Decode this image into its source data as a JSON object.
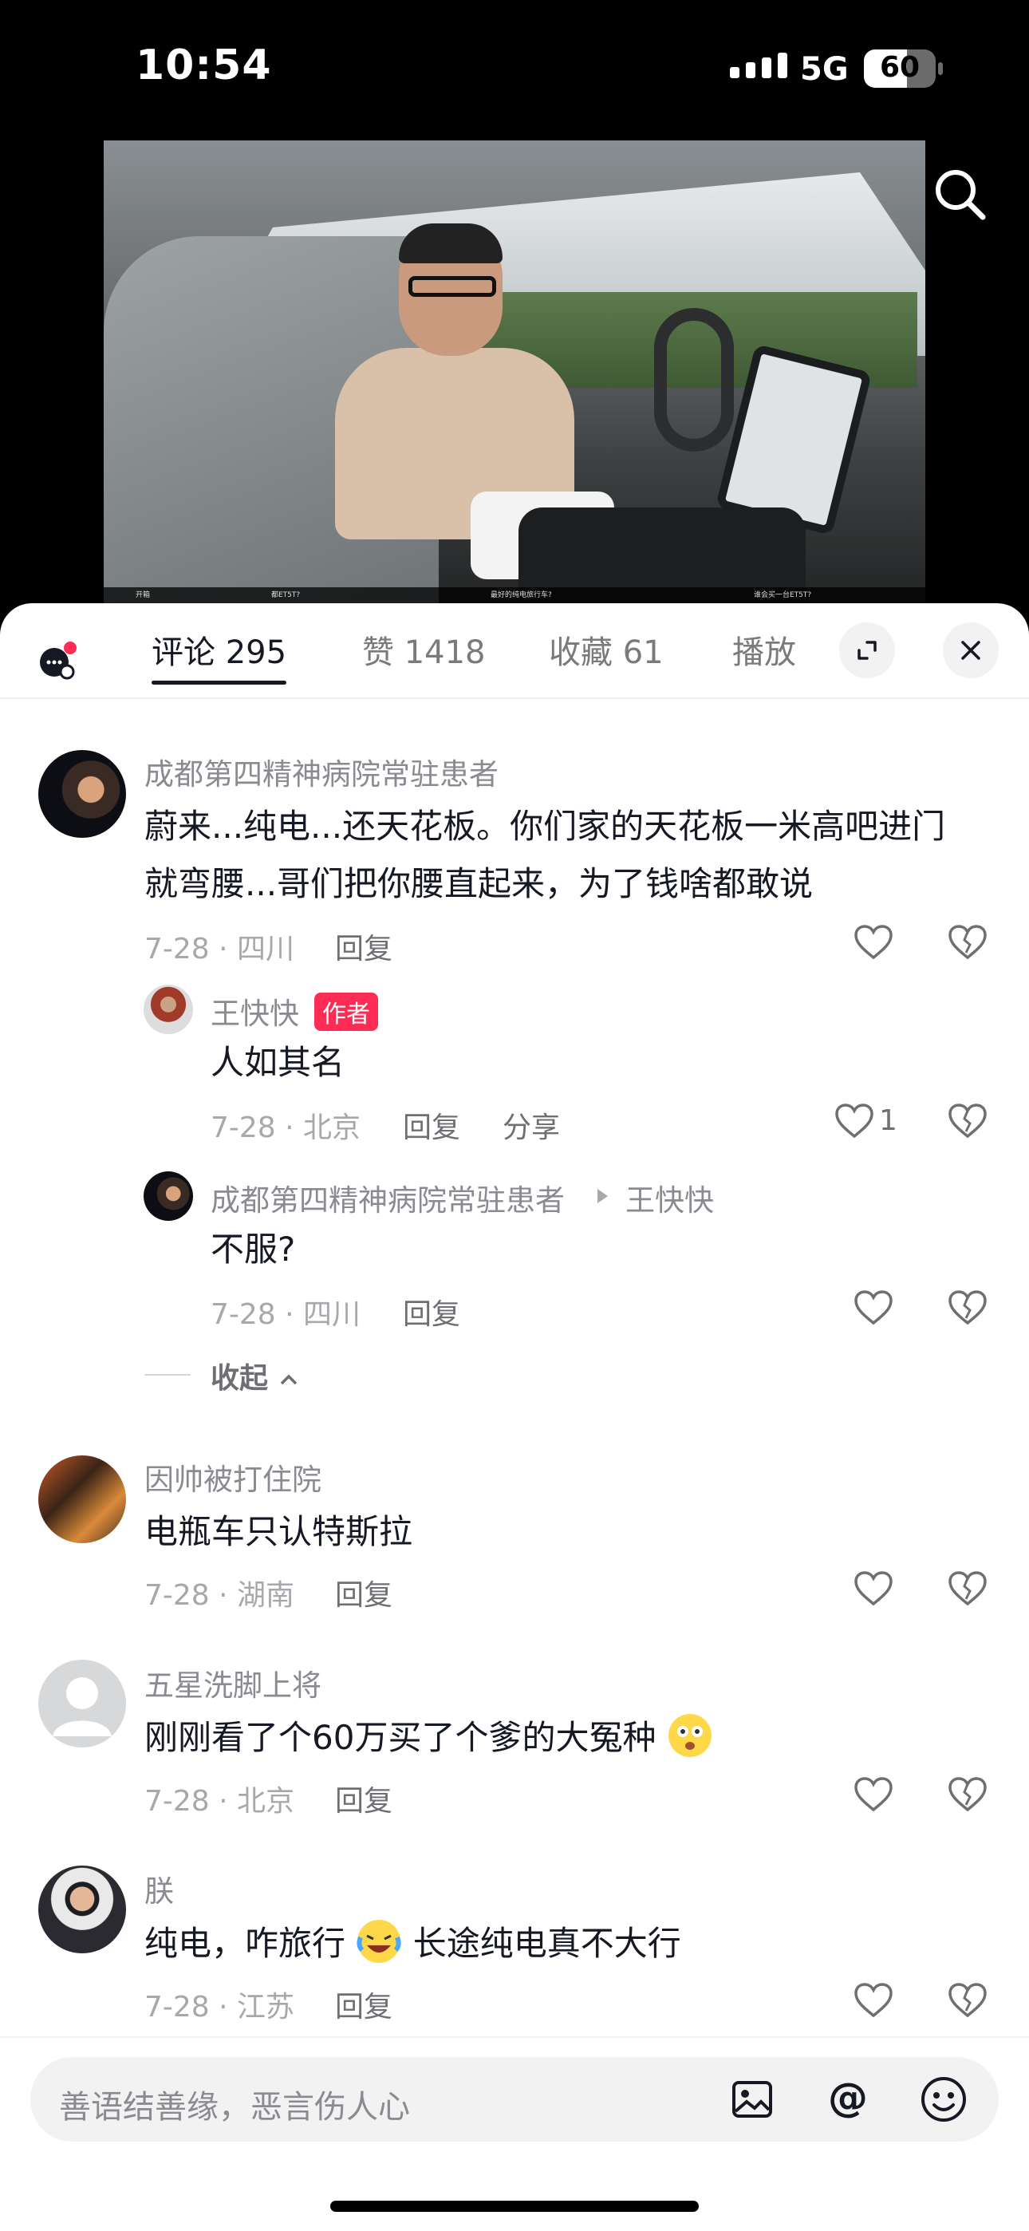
{
  "status": {
    "time": "10:54",
    "network": "5G",
    "battery": "60",
    "battery_level": 0.6
  },
  "video": {
    "captions": [
      "开箱",
      "都ET5T?",
      "最好的纯电旅行车?",
      "谁会买一台ET5T?"
    ]
  },
  "tabs": [
    {
      "label": "评论 295",
      "active": true
    },
    {
      "label": "赞 1418"
    },
    {
      "label": "收藏 61"
    },
    {
      "label": "播放"
    }
  ],
  "comments": [
    {
      "user": "成都第四精神病院常驻患者",
      "lines": [
        "蔚来...纯电...还天花板。你们家的天花板一米高吧进门",
        "就弯腰...哥们把你腰直起来，为了钱啥都敢说"
      ],
      "meta": "7-28 · 四川",
      "reply": "回复"
    },
    {
      "user": "王快快",
      "badge": "作者",
      "text": "人如其名",
      "meta": "7-28 · 北京",
      "reply": "回复",
      "share": "分享",
      "likes": "1"
    },
    {
      "user": "成都第四精神病院常驻患者",
      "reply_to": "王快快",
      "text": "不服?",
      "meta": "7-28 · 四川",
      "reply": "回复"
    },
    {
      "collapse": "收起"
    },
    {
      "user": "因帅被打住院",
      "text": "电瓶车只认特斯拉",
      "meta": "7-28 · 湖南",
      "reply": "回复"
    },
    {
      "user": "五星洗脚上将",
      "text": "刚刚看了个60万买了个爹的大冤种",
      "meta": "7-28 · 北京",
      "reply": "回复"
    },
    {
      "user": "朕",
      "text_a": "纯电，咋旅行",
      "text_b": "长途纯电真不大行",
      "meta": "7-28 · 江苏",
      "reply": "回复"
    }
  ],
  "input": {
    "placeholder": "善语结善缘，恶言伤人心"
  },
  "colors": {
    "accent": "#fe2c55",
    "text": "#161823",
    "muted": "#8a8b91"
  }
}
